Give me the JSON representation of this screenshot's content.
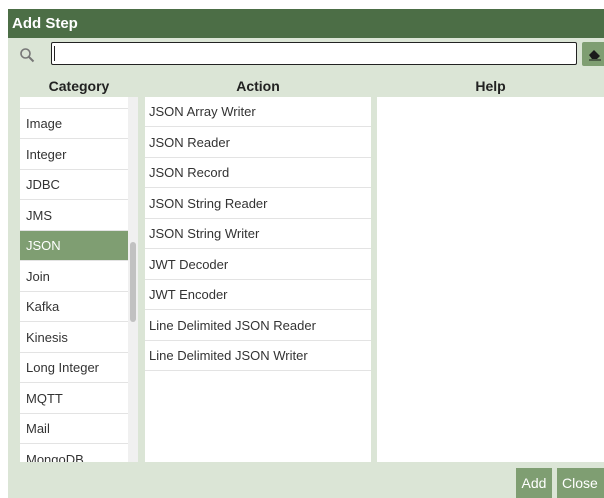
{
  "dialog": {
    "title": "Add Step"
  },
  "search": {
    "value": "",
    "placeholder": ""
  },
  "columns": {
    "category": "Category",
    "action": "Action",
    "help": "Help"
  },
  "categories": {
    "items": [
      "Image",
      "Integer",
      "JDBC",
      "JMS",
      "JSON",
      "Join",
      "Kafka",
      "Kinesis",
      "Long Integer",
      "MQTT",
      "Mail",
      "MongoDB"
    ],
    "selected": "JSON"
  },
  "actions": {
    "items": [
      "JSON Array Writer",
      "JSON Reader",
      "JSON Record",
      "JSON String Reader",
      "JSON String Writer",
      "JWT Decoder",
      "JWT Encoder",
      "Line Delimited JSON Reader",
      "Line Delimited JSON Writer"
    ]
  },
  "help": {
    "text": ""
  },
  "footer": {
    "add_label": "Add",
    "close_label": "Close"
  },
  "colors": {
    "titlebar": "#4c6e46",
    "accent": "#7f9e72",
    "background": "#dbe5d6"
  },
  "icons": {
    "search": "search-icon",
    "clear": "eraser-icon"
  }
}
